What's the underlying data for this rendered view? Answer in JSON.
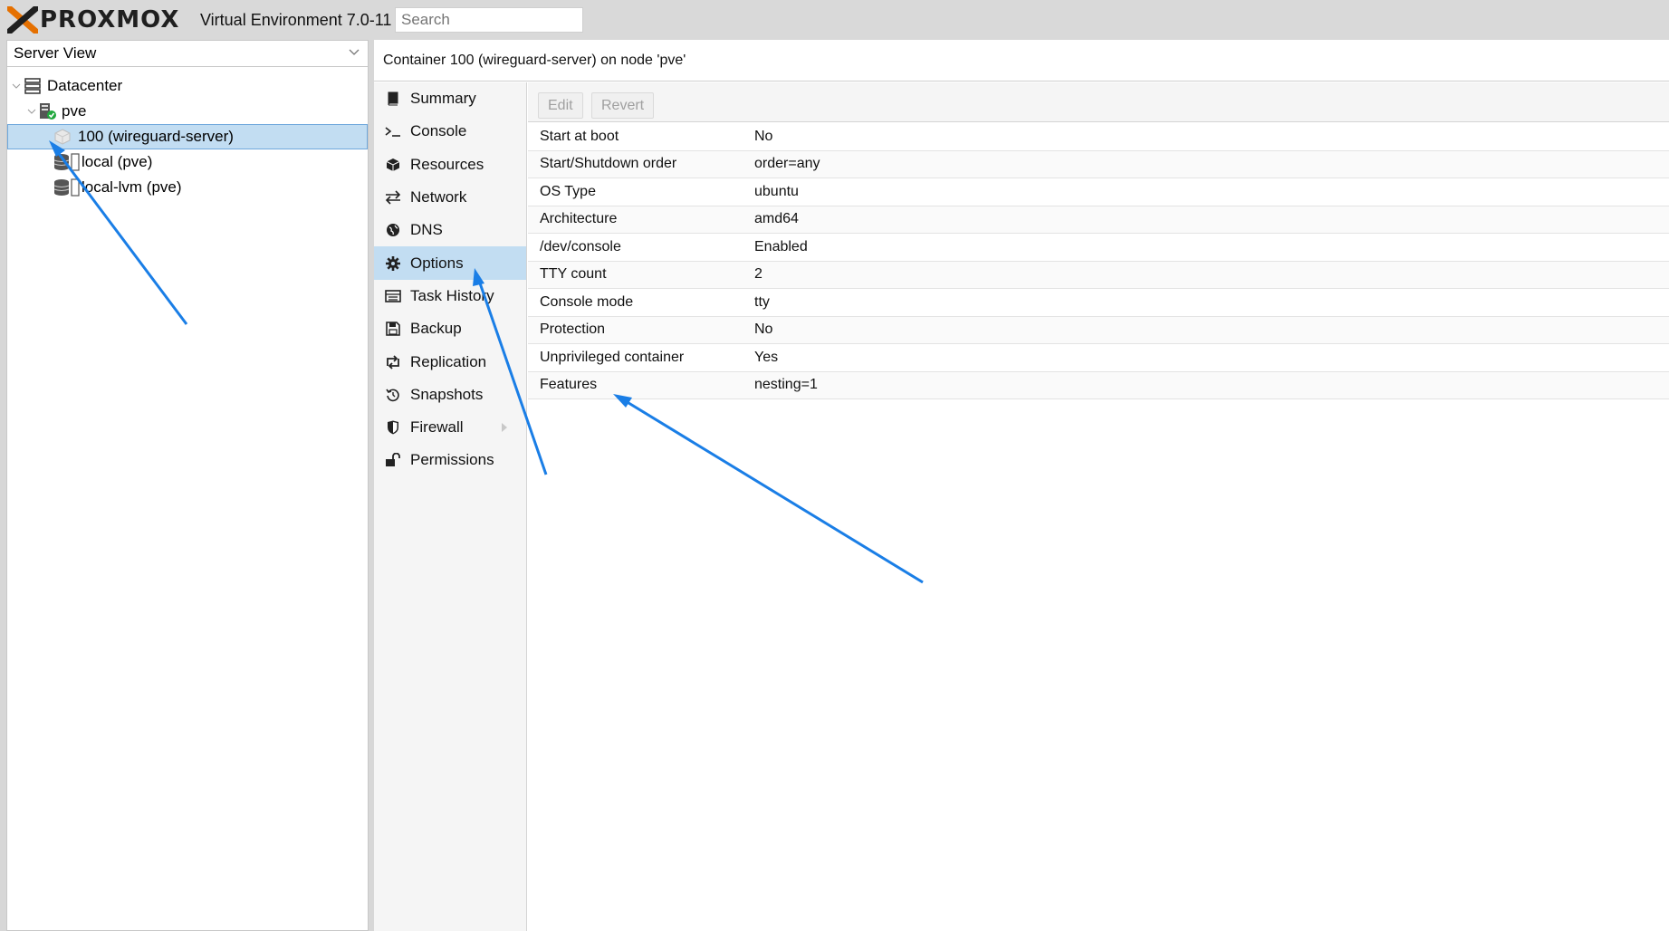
{
  "header": {
    "brand": "PROXMOX",
    "version_label": "Virtual Environment 7.0-11",
    "search_placeholder": "Search"
  },
  "left_panel": {
    "view_select": "Server View",
    "tree": [
      {
        "label": "Datacenter",
        "icon": "datacenter-icon"
      },
      {
        "label": "pve",
        "icon": "node-online-icon"
      },
      {
        "label": "100 (wireguard-server)",
        "icon": "container-icon",
        "selected": true
      },
      {
        "label": "local (pve)",
        "icon": "storage-icon"
      },
      {
        "label": "local-lvm (pve)",
        "icon": "storage-icon"
      }
    ]
  },
  "content": {
    "title": "Container 100 (wireguard-server) on node 'pve'",
    "nav": [
      {
        "label": "Summary",
        "icon": "book-icon"
      },
      {
        "label": "Console",
        "icon": "terminal-icon"
      },
      {
        "label": "Resources",
        "icon": "cube-icon"
      },
      {
        "label": "Network",
        "icon": "exchange-icon"
      },
      {
        "label": "DNS",
        "icon": "globe-icon"
      },
      {
        "label": "Options",
        "icon": "gear-icon",
        "active": true
      },
      {
        "label": "Task History",
        "icon": "list-icon"
      },
      {
        "label": "Backup",
        "icon": "floppy-icon"
      },
      {
        "label": "Replication",
        "icon": "retweet-icon"
      },
      {
        "label": "Snapshots",
        "icon": "history-icon"
      },
      {
        "label": "Firewall",
        "icon": "shield-icon",
        "has_submenu": true
      },
      {
        "label": "Permissions",
        "icon": "unlock-icon"
      }
    ],
    "toolbar": {
      "edit_label": "Edit",
      "revert_label": "Revert"
    },
    "options": [
      {
        "key": "Start at boot",
        "value": "No"
      },
      {
        "key": "Start/Shutdown order",
        "value": "order=any"
      },
      {
        "key": "OS Type",
        "value": "ubuntu"
      },
      {
        "key": "Architecture",
        "value": "amd64"
      },
      {
        "key": "/dev/console",
        "value": "Enabled"
      },
      {
        "key": "TTY count",
        "value": "2"
      },
      {
        "key": "Console mode",
        "value": "tty"
      },
      {
        "key": "Protection",
        "value": "No"
      },
      {
        "key": "Unprivileged container",
        "value": "Yes"
      },
      {
        "key": "Features",
        "value": "nesting=1"
      }
    ]
  },
  "colors": {
    "accent_orange": "#e57000",
    "selection_blue": "#c2ddf2",
    "annotation_arrow": "#1a7ee6"
  }
}
